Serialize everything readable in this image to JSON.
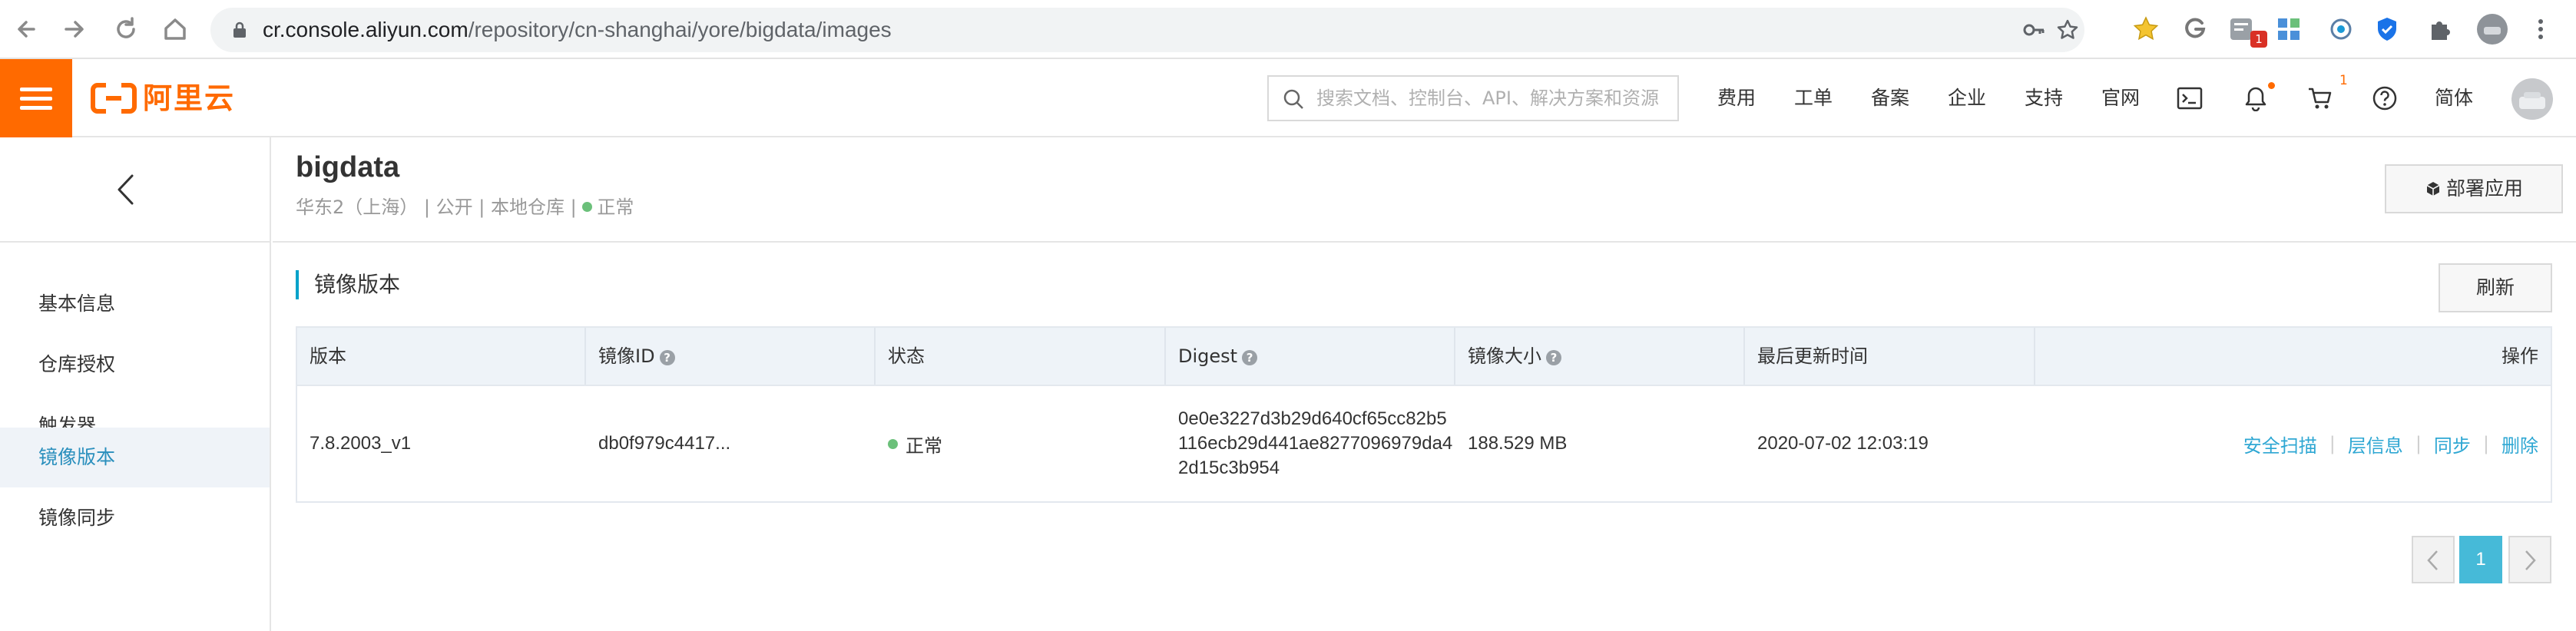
{
  "browser": {
    "url_host": "cr.console.aliyun.com",
    "url_path": "/repository/cn-shanghai/yore/bigdata/images",
    "extension_badge": "1"
  },
  "topbar": {
    "logo_text": "阿里云",
    "search_placeholder": "搜索文档、控制台、API、解决方案和资源",
    "nav": [
      "费用",
      "工单",
      "备案",
      "企业",
      "支持",
      "官网"
    ],
    "cart_count": "1",
    "language": "简体",
    "brand_color": "#ff6a00"
  },
  "sidebar": {
    "items": [
      "基本信息",
      "仓库授权",
      "触发器",
      "镜像版本",
      "镜像同步"
    ],
    "active_index": 3
  },
  "repo": {
    "name": "bigdata",
    "region": "华东2（上海）",
    "visibility": "公开",
    "type": "本地仓库",
    "status": "正常",
    "deploy_label": "部署应用"
  },
  "section": {
    "title": "镜像版本",
    "refresh_label": "刷新"
  },
  "table": {
    "headers": [
      "版本",
      "镜像ID",
      "状态",
      "Digest",
      "镜像大小",
      "最后更新时间",
      "操作"
    ],
    "rows": [
      {
        "version": "7.8.2003_v1",
        "image_id": "db0f979c4417...",
        "status": "正常",
        "digest": "0e0e3227d3b29d640cf65cc82b5116ecb29d441ae8277096979da42d15c3b954",
        "size": "188.529 MB",
        "updated": "2020-07-02 12:03:19",
        "actions": [
          "安全扫描",
          "层信息",
          "同步",
          "删除"
        ]
      }
    ]
  },
  "pagination": {
    "current_page": "1"
  }
}
